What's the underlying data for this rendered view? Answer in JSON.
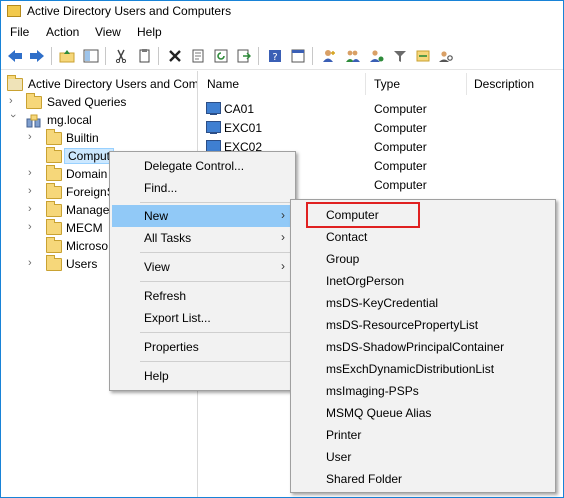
{
  "window": {
    "title": "Active Directory Users and Computers"
  },
  "menubar": {
    "items": [
      "File",
      "Action",
      "View",
      "Help"
    ]
  },
  "toolbar": {
    "icons": [
      "back-arrow-icon",
      "forward-arrow-icon",
      "up-folder-icon",
      "show-tree-icon",
      "cut-icon",
      "copy-icon",
      "delete-icon",
      "properties-icon",
      "refresh-icon",
      "export-list-icon",
      "help-icon",
      "console-icon",
      "add-user-icon",
      "add-group-icon",
      "filter-icon",
      "add-to-group-icon",
      "delegate-icon"
    ]
  },
  "tree": {
    "root": "Active Directory Users and Com",
    "items": [
      {
        "label": "Saved Queries"
      },
      {
        "label": "mg.local"
      },
      {
        "label": "Builtin"
      },
      {
        "label": "Comput"
      },
      {
        "label": "Domain"
      },
      {
        "label": "ForeignS"
      },
      {
        "label": "Manage"
      },
      {
        "label": "MECM"
      },
      {
        "label": "Microso"
      },
      {
        "label": "Users"
      }
    ]
  },
  "list": {
    "columns": [
      "Name",
      "Type",
      "Description"
    ],
    "rows": [
      {
        "name": "CA01",
        "type": "Computer"
      },
      {
        "name": "EXC01",
        "type": "Computer"
      },
      {
        "name": "EXC02",
        "type": "Computer"
      },
      {
        "name": "",
        "type": "Computer"
      },
      {
        "name": "",
        "type": "Computer"
      }
    ]
  },
  "context_menu": {
    "delegate": "Delegate Control...",
    "find": "Find...",
    "new": "New",
    "all_tasks": "All Tasks",
    "view": "View",
    "refresh": "Refresh",
    "export": "Export List...",
    "properties": "Properties",
    "help": "Help",
    "submenu_arrow": "›"
  },
  "new_submenu": {
    "items": [
      "Computer",
      "Contact",
      "Group",
      "InetOrgPerson",
      "msDS-KeyCredential",
      "msDS-ResourcePropertyList",
      "msDS-ShadowPrincipalContainer",
      "msExchDynamicDistributionList",
      "msImaging-PSPs",
      "MSMQ Queue Alias",
      "Printer",
      "User",
      "Shared Folder"
    ],
    "highlighted": "Computer"
  },
  "colors": {
    "menu_highlight": "#91c9f7",
    "annotation_box": "#e02020",
    "window_border": "#1883d7"
  }
}
